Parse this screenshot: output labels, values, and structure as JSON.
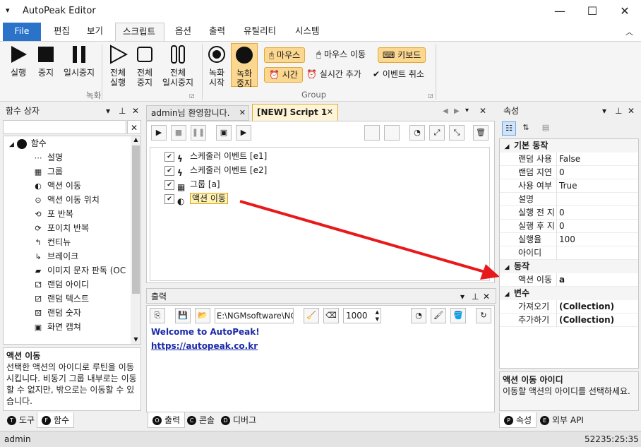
{
  "window": {
    "title": "AutoPeak Editor"
  },
  "menu": [
    "File",
    "편집",
    "보기",
    "스크립트",
    "옵션",
    "출력",
    "유틸리티",
    "시스템"
  ],
  "ribbon": {
    "run": "실행",
    "stop": "중지",
    "pause": "일시중지",
    "all_run": [
      "전체",
      "실행"
    ],
    "all_stop": [
      "전체",
      "중지"
    ],
    "all_pause": [
      "전체",
      "일시중지"
    ],
    "rec_start": [
      "녹화",
      "시작"
    ],
    "rec_stop": [
      "녹화",
      "중지"
    ],
    "group_record": "녹화",
    "group_group": "Group",
    "mouse": "마우스",
    "mouse_move": "마우스 이동",
    "keyboard": "키보드",
    "time": "시간",
    "realtime_add": "실시간 추가",
    "event_cancel": "이벤트 취소"
  },
  "left": {
    "title": "함수 상자",
    "root": "함수",
    "items": [
      "설명",
      "그룹",
      "액션 이동",
      "액션 이동 위치",
      "포 반복",
      "포이치 반복",
      "컨티뉴",
      "브레이크",
      "이미지 문자 판독 (OC",
      "랜덤 아이디",
      "랜덤 텍스트",
      "랜덤 숫자",
      "화면 캡쳐"
    ],
    "desc_title": "액션 이동",
    "desc_text": "선택한 액션의 아이디로 루틴을 이동시킵니다. 비동기 그룹 내부로는 이동할 수 없지만, 밖으로는 이동할 수 있습니다.",
    "tabs": [
      "도구",
      "함수"
    ]
  },
  "doc": {
    "tabs": [
      "admin님 환영합니다.",
      "[NEW] Script 1"
    ],
    "tree": [
      "스케줄러 이벤트 [e1]",
      "스케줄러 이벤트 [e2]",
      "그룹 [a]",
      "액션 이동"
    ]
  },
  "output": {
    "title": "출력",
    "path": "E:\\NGMsoftware\\NG",
    "num": "1000",
    "line1": "Welcome to AutoPeak!",
    "line2": "https://autopeak.co.kr",
    "tabs": [
      "출력",
      "콘솔",
      "디버그"
    ]
  },
  "props": {
    "title": "속성",
    "sec1": "기본 동작",
    "rows1": [
      [
        "랜덤 사용",
        "False"
      ],
      [
        "랜덤 지연",
        "0"
      ],
      [
        "사용 여부",
        "True"
      ],
      [
        "설명",
        ""
      ],
      [
        "실행 전 지",
        "0"
      ],
      [
        "실행 후 지",
        "0"
      ],
      [
        "실행율",
        "100"
      ],
      [
        "아이디",
        ""
      ]
    ],
    "sec2": "동작",
    "rows2": [
      [
        "액션 이동",
        "a"
      ]
    ],
    "sec3": "변수",
    "rows3": [
      [
        "가져오기",
        "(Collection)"
      ],
      [
        "추가하기",
        "(Collection)"
      ]
    ],
    "desc_title": "액션 이동 아이디",
    "desc_text": "이동할 액션의 아이디를 선택하세요.",
    "tabs": [
      "속성",
      "외부 API"
    ]
  },
  "status": {
    "user": "admin",
    "time": "52235:25:35"
  }
}
